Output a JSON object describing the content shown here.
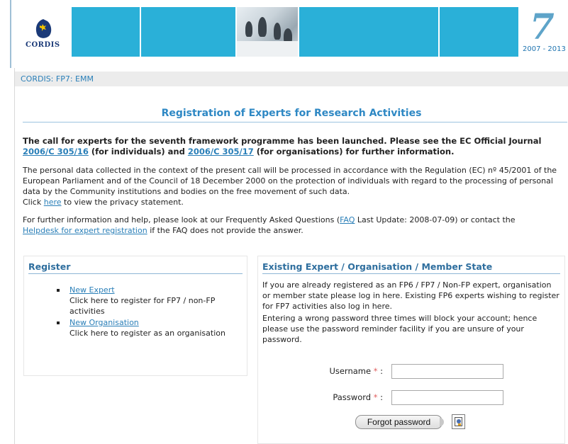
{
  "banner": {
    "logo_text": "CORDIS",
    "years": "2007 - 2013",
    "fp7_mark": "7",
    "brand_color": "#2ab0d8"
  },
  "breadcrumb": "CORDIS: FP7: EMM",
  "main": {
    "title": "Registration of Experts for Research Activities",
    "call_intro": "The call for experts for the seventh framework programme has been launched. Please see the EC Official Journal",
    "call_link1": "2006/C 305/16",
    "call_mid": "(for individuals) and",
    "call_link2": "2006/C 305/17",
    "call_end": "(for organisations) for further information.",
    "privacy_text": "The personal data collected in the context of the present call will be processed in accordance with the Regulation (EC) nº 45/2001 of the European Parliament and of the Council of 18 December 2000 on the protection of individuals with regard to the processing of personal data by the Community institutions and bodies on the free movement of such data.",
    "privacy_click": "Click",
    "privacy_link": "here",
    "privacy_end": "to view the privacy statement.",
    "help_start": "For further information and help, please look at our Frequently Asked Questions (",
    "faq_link": "FAQ",
    "help_mid": "Last Update: 2008-07-09) or contact the",
    "helpdesk_link": "Helpdesk for expert registration",
    "help_end": "if the FAQ does not provide the answer."
  },
  "register": {
    "title": "Register",
    "items": [
      {
        "link": "New Expert",
        "desc": "Click here to register for FP7 / non-FP activities"
      },
      {
        "link": "New Organisation",
        "desc": "Click here to register as an organisation"
      }
    ]
  },
  "existing": {
    "title": "Existing Expert / Organisation / Member State",
    "info1": "If you are already registered as an FP6 / FP7 / Non-FP expert, organisation or member state please log in here. Existing FP6 experts wishing to register for FP7 activities also log in here.",
    "info2": "Entering a wrong password three times will block your account; hence please use the password reminder facility if you are unsure of your password.",
    "username_label": "Username",
    "password_label": "Password",
    "required_mark": "*",
    "label_suffix": ":",
    "username_value": "",
    "password_value": "",
    "forgot_label": "Forgot password"
  }
}
